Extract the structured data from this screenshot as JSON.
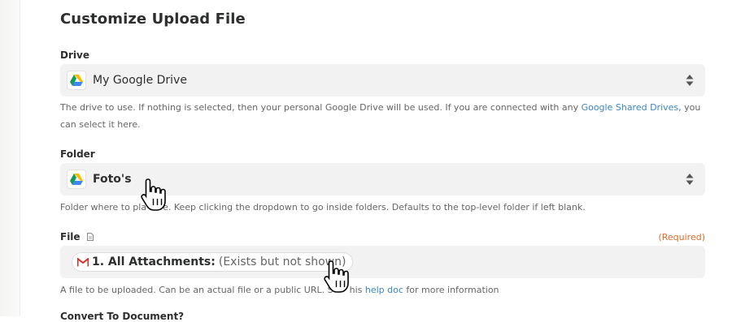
{
  "page": {
    "title": "Customize Upload File"
  },
  "drive": {
    "label": "Drive",
    "value": "My Google Drive",
    "help_prefix": "The drive to use. If nothing is selected, then your personal Google Drive will be used. If you are connected with any ",
    "help_link": "Google Shared Drives",
    "help_suffix": ", you can select it here."
  },
  "folder": {
    "label": "Folder",
    "value": "Foto's",
    "help_part1": "Folder where to pla",
    "help_part2": "e. Keep clicking the dropdown to go inside folders. Defaults to the top-level folder if left blank."
  },
  "file": {
    "label": "File",
    "required": "(Required)",
    "pill_name": "1. All Attachments:",
    "pill_note": "(Exists but not shown)",
    "help_part1": "A file to be uploaded. Can be an actual file or a public URL. S",
    "help_part2": "his ",
    "help_link": "help doc",
    "help_suffix": " for more information"
  },
  "next_field_partial": {
    "label": "Convert To Document?"
  },
  "colors": {
    "link": "#3d86c6",
    "required": "#e06b2d",
    "field_bg": "#f2f2f2",
    "gmail_red": "#d93025"
  },
  "icons": [
    "google-drive-icon",
    "chevron-updown-icon",
    "gmail-icon",
    "file-doc-icon",
    "hand-pointer-icon"
  ]
}
